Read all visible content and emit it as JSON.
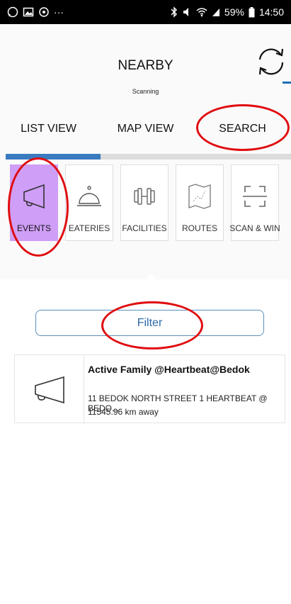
{
  "status_bar": {
    "battery": "59%",
    "time": "14:50"
  },
  "header": {
    "title": "NEARBY",
    "subtitle": "Scanning",
    "refresh_icon": "refresh-icon"
  },
  "tabs": [
    {
      "label": "LIST VIEW"
    },
    {
      "label": "MAP VIEW"
    },
    {
      "label": "SEARCH"
    }
  ],
  "categories": [
    {
      "label": "EVENTS",
      "icon": "megaphone-icon",
      "active": true
    },
    {
      "label": "EATERIES",
      "icon": "cloche-icon",
      "active": false
    },
    {
      "label": "FACILITIES",
      "icon": "dumbbell-icon",
      "active": false
    },
    {
      "label": "ROUTES",
      "icon": "map-icon",
      "active": false
    },
    {
      "label": "SCAN & WIN",
      "icon": "scan-icon",
      "active": false
    }
  ],
  "filter": {
    "label": "Filter"
  },
  "events": [
    {
      "name": "Active Family @Heartbeat@Bedok",
      "address": "11 BEDOK NORTH STREET 1 HEARTBEAT @ BEDO...",
      "distance": "11545.96 km away",
      "icon": "megaphone-icon"
    }
  ],
  "colors": {
    "accent": "#3a7bbf",
    "active_category": "#cf9ef7",
    "highlight": "#e00c10"
  }
}
